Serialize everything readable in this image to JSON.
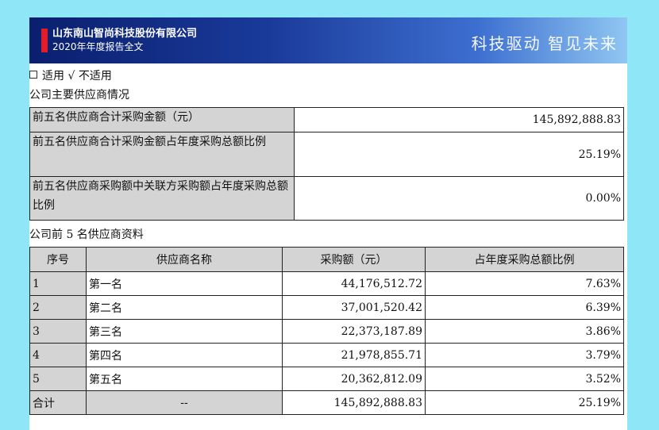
{
  "header": {
    "company": "山东南山智尚科技股份有限公司",
    "report": "2020年年度报告全文",
    "slogan": "科技驱动 智见未来"
  },
  "applicable": {
    "option1": "适用",
    "option2_check": "√",
    "option2": "不适用"
  },
  "summary": {
    "title": "公司主要供应商情况",
    "rows": [
      {
        "label": "前五名供应商合计采购金额（元）",
        "value": "145,892,888.83"
      },
      {
        "label": "前五名供应商合计采购金额占年度采购总额比例",
        "value": "25.19%"
      },
      {
        "label": "前五名供应商采购额中关联方采购额占年度采购总额比例",
        "value": "0.00%"
      }
    ]
  },
  "top5": {
    "title": "公司前 5 名供应商资料",
    "headers": [
      "序号",
      "供应商名称",
      "采购额（元）",
      "占年度采购总额比例"
    ],
    "rows": [
      {
        "idx": "1",
        "name": "第一名",
        "amount": "44,176,512.72",
        "pct": "7.63%"
      },
      {
        "idx": "2",
        "name": "第二名",
        "amount": "37,001,520.42",
        "pct": "6.39%"
      },
      {
        "idx": "3",
        "name": "第三名",
        "amount": "22,373,187.89",
        "pct": "3.86%"
      },
      {
        "idx": "4",
        "name": "第四名",
        "amount": "21,978,855.71",
        "pct": "3.79%"
      },
      {
        "idx": "5",
        "name": "第五名",
        "amount": "20,362,812.09",
        "pct": "3.52%"
      }
    ],
    "total": {
      "idx": "合计",
      "name": "--",
      "amount": "145,892,888.83",
      "pct": "25.19%"
    }
  }
}
